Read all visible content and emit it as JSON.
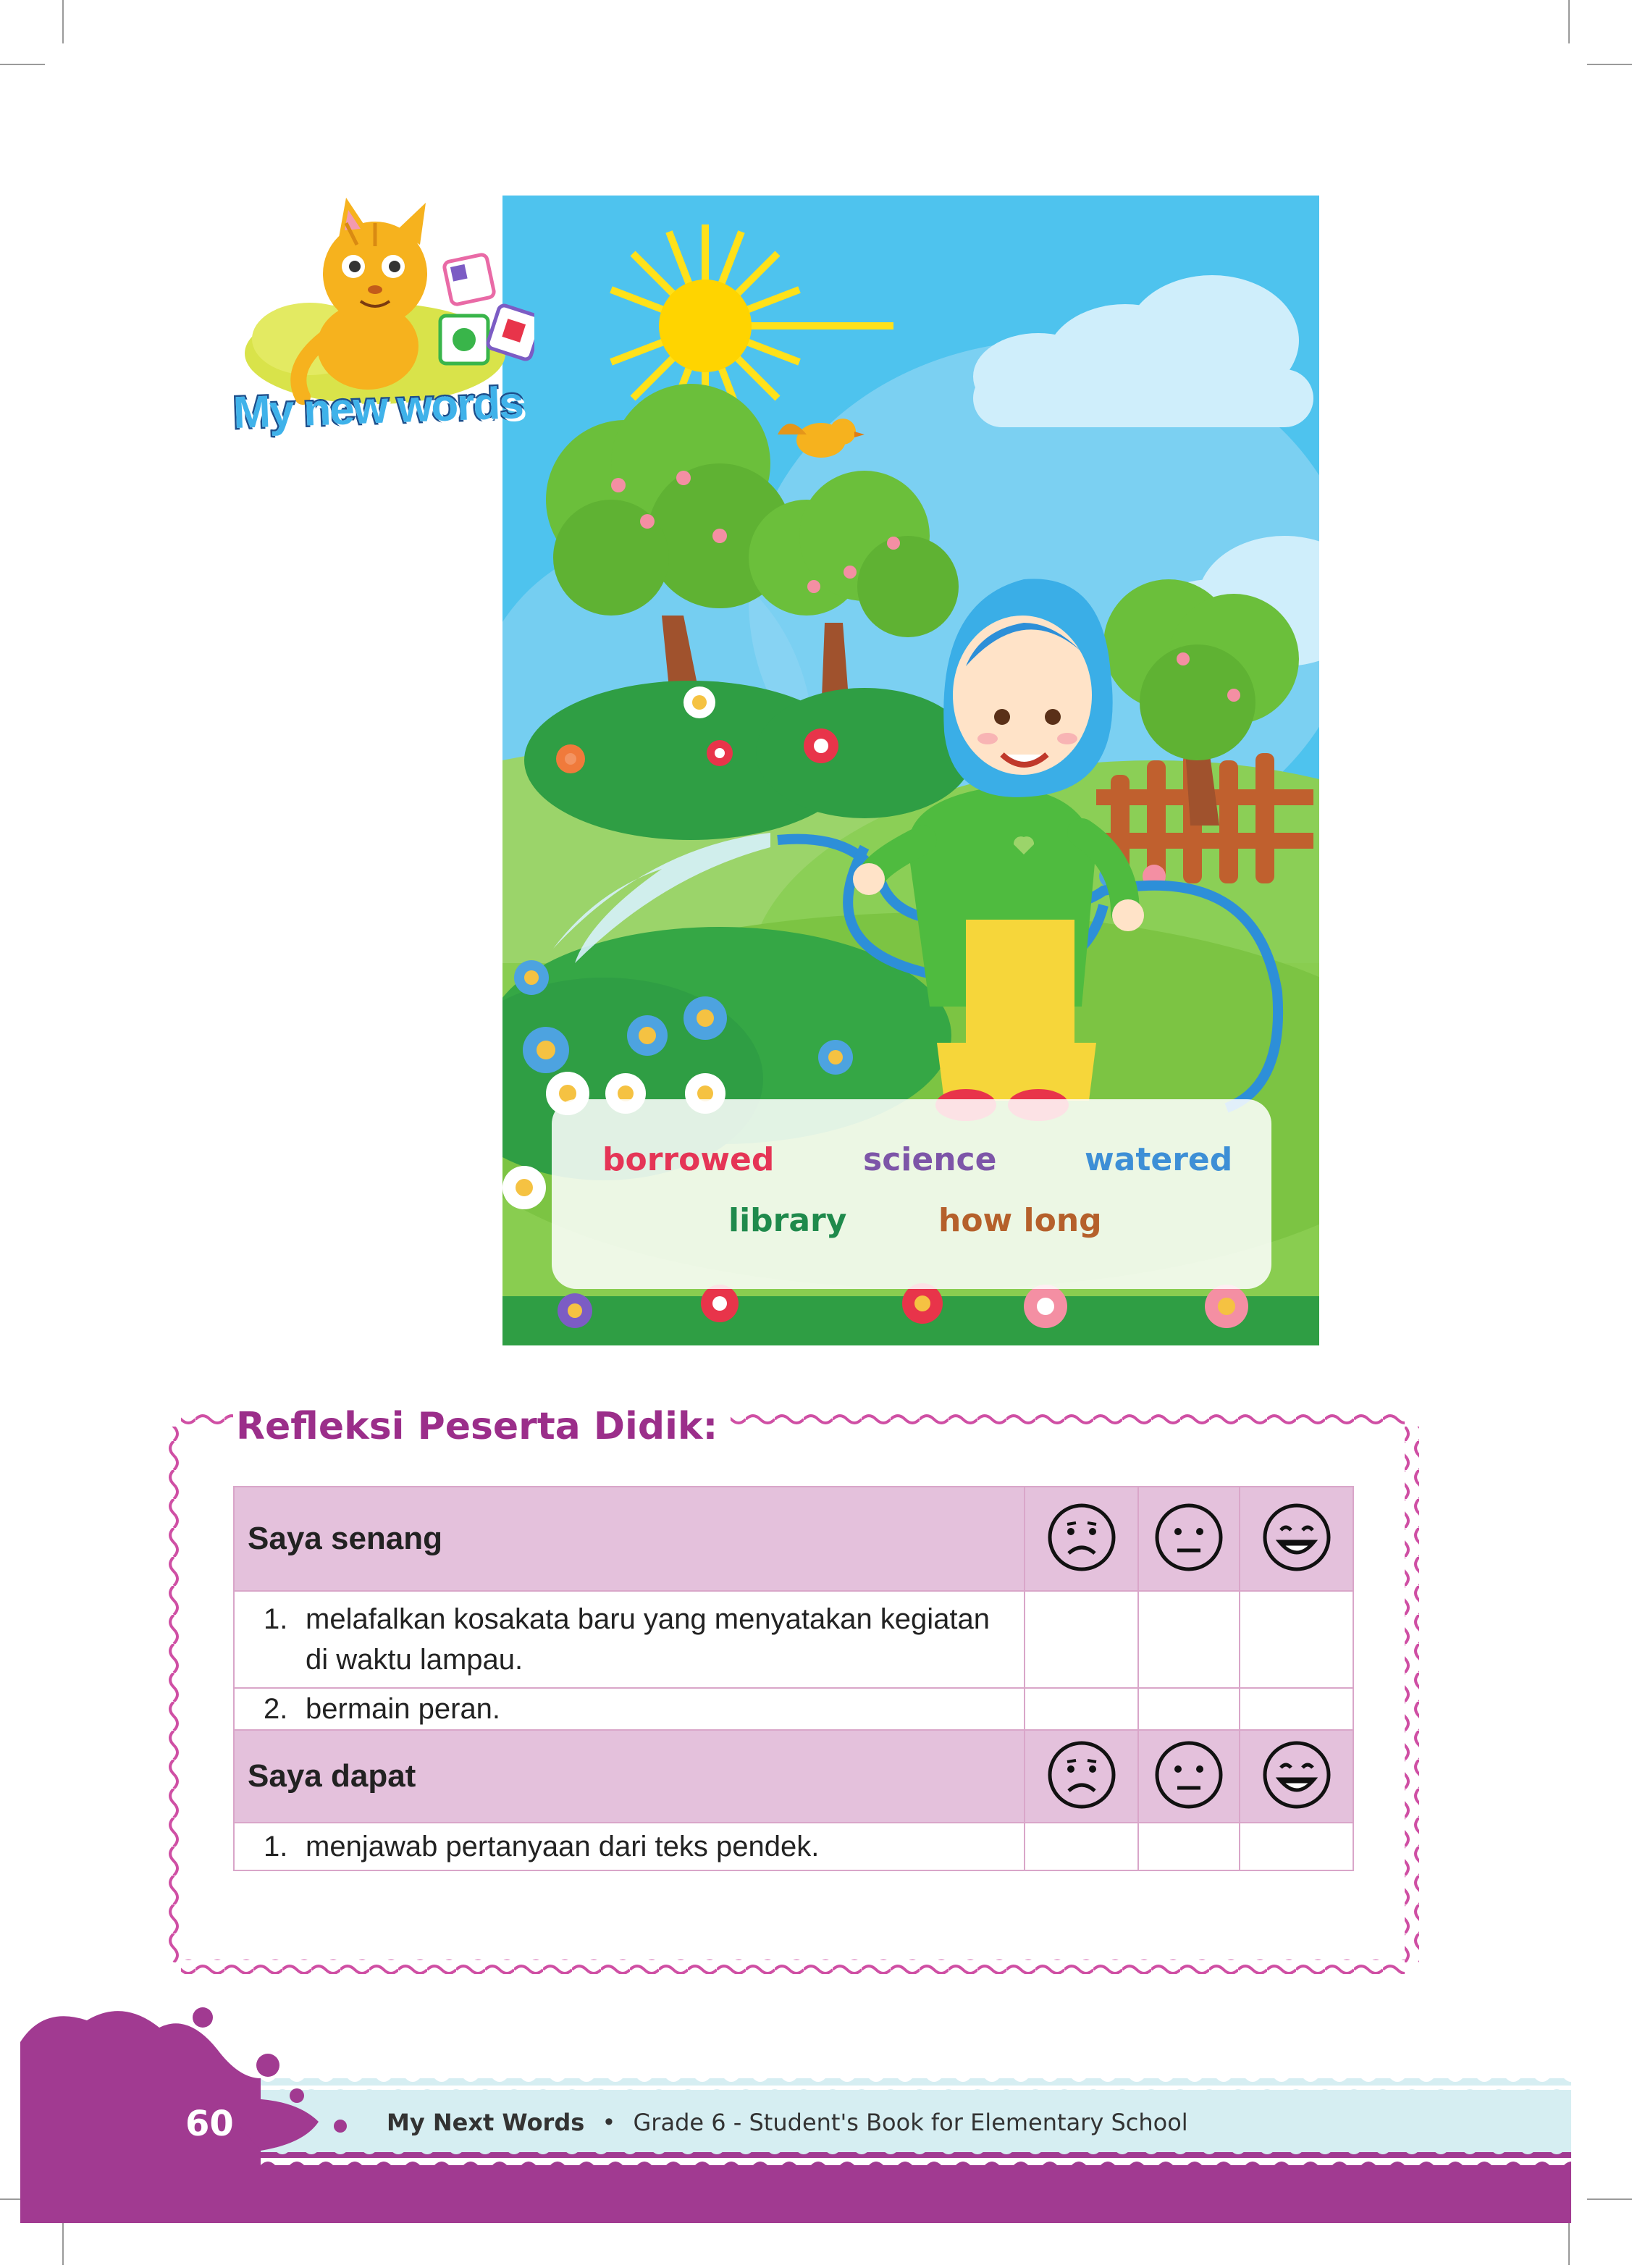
{
  "header": {
    "badge_title": "My new words"
  },
  "vocabulary": {
    "words": [
      {
        "text": "borrowed",
        "color": "#e53556"
      },
      {
        "text": "science",
        "color": "#7d55a8"
      },
      {
        "text": "watered",
        "color": "#3d8fd6"
      },
      {
        "text": "library",
        "color": "#1f8a4c"
      },
      {
        "text": "how long",
        "color": "#b5602b"
      }
    ]
  },
  "reflection": {
    "title": "Refleksi Peserta Didik:",
    "sections": [
      {
        "heading": "Saya senang",
        "items": [
          {
            "num": "1.",
            "text": "melafalkan kosakata baru yang menyatakan kegiatan di waktu lampau."
          },
          {
            "num": "2.",
            "text": "bermain peran."
          }
        ]
      },
      {
        "heading": "Saya dapat",
        "items": [
          {
            "num": "1.",
            "text": "menjawab pertanyaan dari teks pendek."
          }
        ]
      }
    ],
    "faces": [
      "sad-face-icon",
      "neutral-face-icon",
      "happy-face-icon"
    ]
  },
  "footer": {
    "page_number": "60",
    "book_title": "My Next Words",
    "separator": "•",
    "subtitle": "Grade 6 - Student's Book for Elementary School"
  },
  "colors": {
    "accent_purple": "#a13a91",
    "table_header": "#e4c1dc",
    "sky": "#4ec3ee",
    "grass": "#7cc443"
  }
}
